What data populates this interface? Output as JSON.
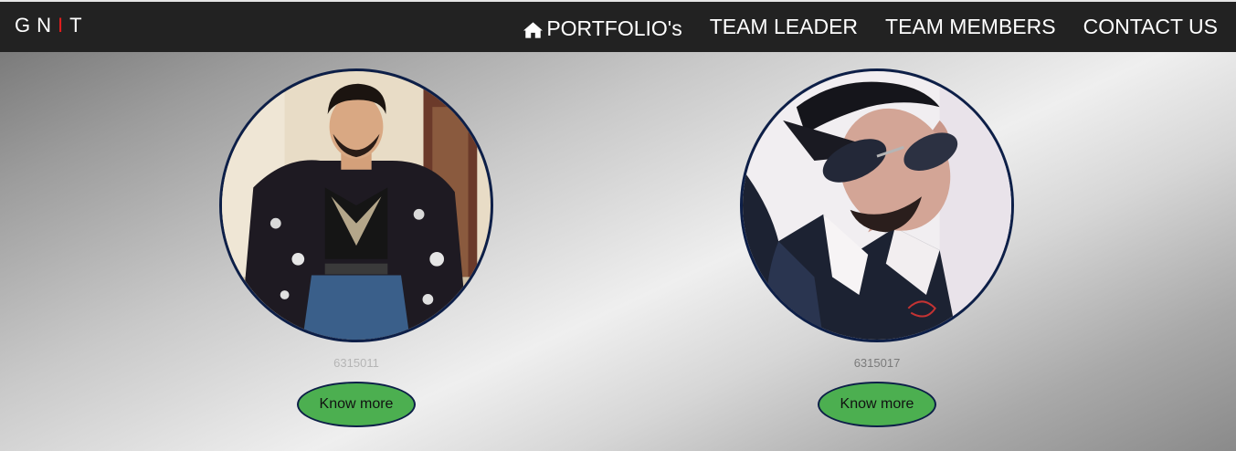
{
  "brand": {
    "g": "G",
    "n": "N",
    "i": "I",
    "t": "T",
    "accent_color": "#e11d1d"
  },
  "nav": {
    "items": [
      {
        "label": "PORTFOLIO's",
        "icon": "home-icon"
      },
      {
        "label": "TEAM LEADER"
      },
      {
        "label": "TEAM MEMBERS"
      },
      {
        "label": "CONTACT US"
      }
    ]
  },
  "cards": [
    {
      "id": "6315011",
      "button_label": "Know more"
    },
    {
      "id": "6315017",
      "button_label": "Know more"
    }
  ],
  "colors": {
    "topbar": "#222222",
    "button": "#4caf50",
    "ring": "#0d1f48"
  }
}
